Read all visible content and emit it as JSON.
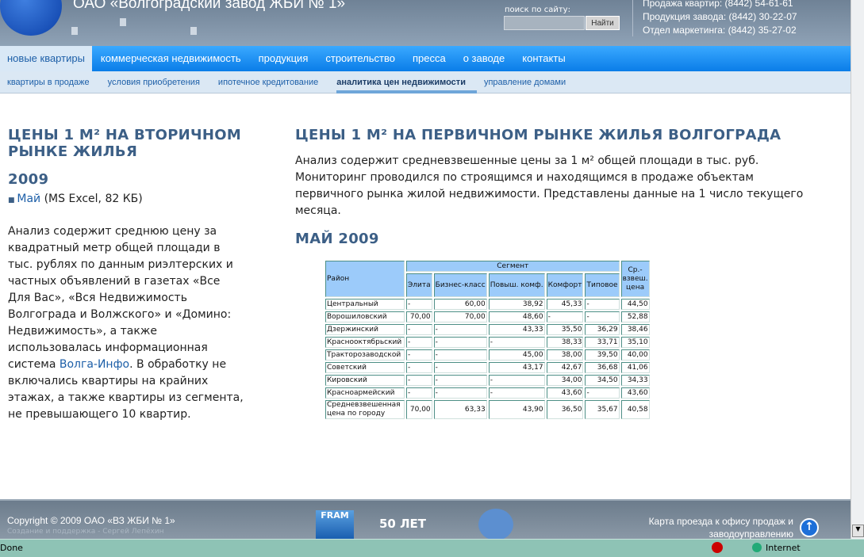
{
  "header": {
    "title": "ОАО «Волгоградский завод ЖБИ № 1»",
    "search_label": "поиск по сайту:",
    "search_value": "",
    "search_button": "Найти",
    "contacts": [
      "Продажа квартир: (8442) 54-61-61",
      "Продукция завода: (8442) 30-22-07",
      "Отдел маркетинга: (8442) 35-27-02"
    ]
  },
  "nav": [
    "новые квартиры",
    "коммерческая недвижимость",
    "продукция",
    "строительство",
    "пресса",
    "о заводе",
    "контакты"
  ],
  "subnav": [
    "квартиры в продаже",
    "условия приобретения",
    "ипотечное кредитование",
    "аналитика цен недвижимости",
    "управление домами"
  ],
  "left": {
    "title": "ЦЕНЫ 1 М² НА ВТОРИЧНОМ РЫНКЕ ЖИЛЬЯ",
    "year": "2009",
    "file_link": "Май",
    "file_info": "(MS Excel, 82 КБ)",
    "text1": "Анализ содержит среднюю цену за квадратный метр общей площади в тыс. рублях по данным риэлтерских и частных объявлений в газетах «Все Для Вас», «Вся Недвижимость Волгограда и Волжского» и «Домино: Недвижимость», а также использовалась информационная система ",
    "link": "Волга-Инфо",
    "text2": ". В обработку не включались квартиры на крайних этажах, а также квартиры из сегмента, не превышающего 10 квартир."
  },
  "main": {
    "title": "ЦЕНЫ 1 М² НА ПЕРВИЧНОМ РЫНКЕ ЖИЛЬЯ ВОЛГОГРАДА",
    "text": "Анализ содержит средневзвешенные цены за 1 м² общей площади в тыс. руб. Мониторинг проводился по строящимся и находящимся в продаже объектам первичного рынка жилой недвижимости. Представлены данные на 1 число текущего месяца.",
    "subtitle": "МАЙ 2009"
  },
  "table": {
    "h_district": "Район",
    "h_segment": "Сегмент",
    "h_avg": "Ср.-взвеш. цена",
    "segments": [
      "Элита",
      "Бизнес-класс",
      "Повыш. комф.",
      "Комфорт",
      "Типовое"
    ],
    "rows": [
      [
        "Центральный",
        "-",
        "60,00",
        "38,92",
        "45,33",
        "-",
        "44,50"
      ],
      [
        "Ворошиловский",
        "70,00",
        "70,00",
        "48,60",
        "-",
        "-",
        "52,88"
      ],
      [
        "Дзержинский",
        "-",
        "-",
        "43,33",
        "35,50",
        "36,29",
        "38,46"
      ],
      [
        "Краснооктябрьский",
        "-",
        "-",
        "-",
        "38,33",
        "33,71",
        "35,10"
      ],
      [
        "Тракторозаводской",
        "-",
        "-",
        "45,00",
        "38,00",
        "39,50",
        "40,00"
      ],
      [
        "Советский",
        "-",
        "-",
        "43,17",
        "42,67",
        "36,68",
        "41,06"
      ],
      [
        "Кировский",
        "-",
        "-",
        "-",
        "34,00",
        "34,50",
        "34,33"
      ],
      [
        "Красноармейский",
        "-",
        "-",
        "-",
        "43,60",
        "-",
        "43,60"
      ],
      [
        "Средневзвешенная цена по городу",
        "70,00",
        "63,33",
        "43,90",
        "36,50",
        "35,67",
        "40,58"
      ]
    ]
  },
  "footer": {
    "copyright": "Copyright © 2009 ОАО «ВЗ ЖБИ № 1»",
    "support": "Создание и поддержка - Сергей Лепёхин",
    "map_link": "Карта проезда к офису продаж и заводоуправлению",
    "logo1": "FRAM",
    "logo2": "50 ЛЕТ"
  },
  "status": {
    "text": "Done",
    "zone": "Internet"
  }
}
